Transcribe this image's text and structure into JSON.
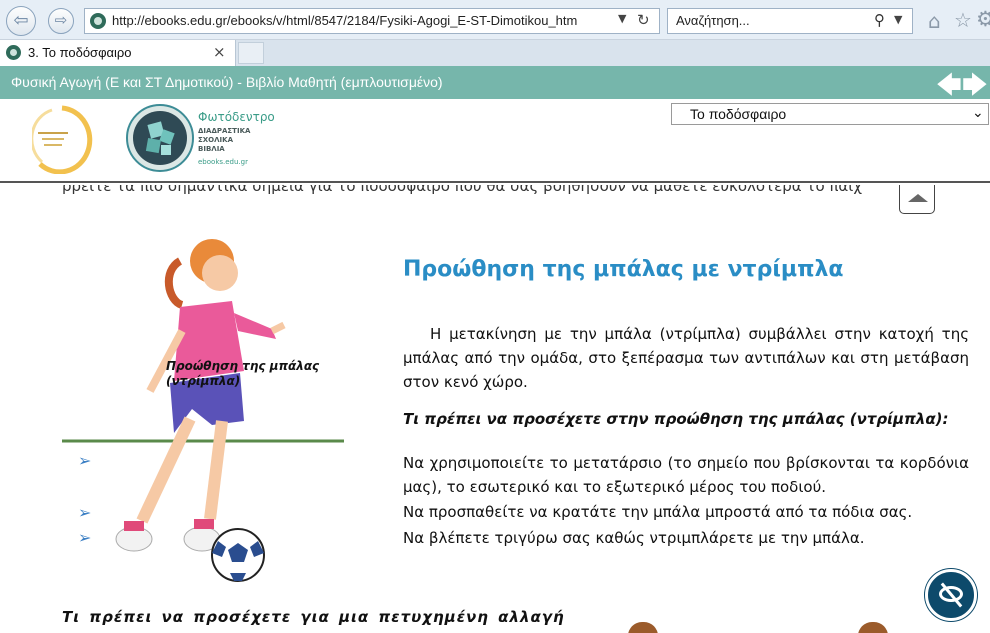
{
  "browser": {
    "url": "http://ebooks.edu.gr/ebooks/v/html/8547/2184/Fysiki-Agogi_E-ST-Dimotikou_htm",
    "search_placeholder": "Αναζήτηση...",
    "tab_title": "3. Το ποδόσφαιρο",
    "back_glyph": "⇦",
    "forward_glyph": "⇨",
    "close_glyph": "×"
  },
  "app": {
    "title": "Φυσική Αγωγή (Ε και ΣΤ Δημοτικού) - Βιβλίο Μαθητή (εμπλουτισμένο)",
    "accent_color": "#76b6ab"
  },
  "logos": {
    "fotodentro_name": "Φωτόδεντρο",
    "fotodentro_lines": [
      "ΔΙΑΔΡΑΣΤΙΚΑ",
      "ΣΧΟΛΙΚΑ",
      "ΒΙΒΛΙΑ"
    ],
    "fotodentro_url": "ebooks.edu.gr"
  },
  "chapter_select": {
    "value": "Το ποδόσφαιρο"
  },
  "content": {
    "cut_line": "ρρείτε τα πιο σημαντικά σημεία για το ποδόσφαιρο που θα σας βοηθήσουν να μάθετε ευκολότερα το παιχ",
    "figure_caption_line1": "Προώθηση της μπάλας",
    "figure_caption_line2": "(ντρίμπλα)",
    "heading": "Προώθηση της μπάλας με ντρίμπλα",
    "paragraph1": "Η μετακίνηση με την μπάλα (ντρίμπλα) συμβάλλει στην κατοχή της μπάλας από την ομάδα, στο ξεπέρασμα των αντιπάλων και στη μετάβαση στον κενό χώρο.",
    "subheading": "Τι πρέπει να προσέχετε στην προώθηση της μπάλας (ντρίμπλα):",
    "tip1": "Να χρησιμοποιείτε το μετατάρσιο (το σημείο που βρίσκονται τα κορδόνια μας), το εσωτερικό και το εξωτερικό μέρος του ποδιού.",
    "tip2": "Να προσπαθείτε να κρατάτε την μπάλα μπροστά από τα πόδια σας.",
    "tip3": "Να βλέπετε τριγύρω σας καθώς ντριμπλάρετε με την μπάλα.",
    "bottom_subheading": "Τι πρέπει να προσέχετε για μια πετυχημένη αλλαγή",
    "bullet_glyph": "➢"
  },
  "icons": {
    "site": "site-favicon-icon",
    "home": "home-icon",
    "star": "favorites-star-icon",
    "gear": "gear-icon",
    "accessibility": "eye-slash-icon"
  }
}
